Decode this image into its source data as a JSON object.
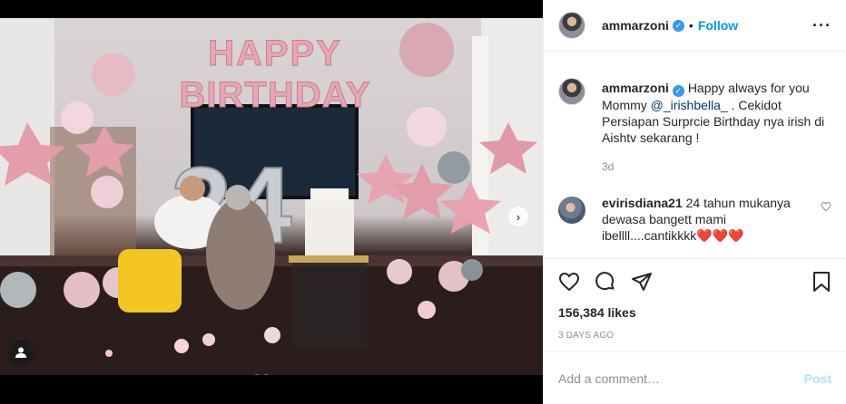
{
  "post": {
    "username": "ammarzoni",
    "follow_label": "Follow",
    "separator": "•",
    "more_icon": "more-horizontal-icon",
    "verified_icon": "verified-badge-icon"
  },
  "photo": {
    "balloon_text_top": "HAPPY",
    "balloon_text_bottom": "BIRTHDAY",
    "number_balloons": "24"
  },
  "caption": {
    "username": "ammarzoni",
    "text_1": "Happy always for you Mommy ",
    "mention": "@_irishbella_",
    "text_2": " . Cekidot Persiapan Surprcie Birthday nya irish di Aishtv sekarang !",
    "time": "3d"
  },
  "comment": {
    "username": "evirisdiana21",
    "text": "24 tahun mukanya dewasa bangett mami ibellll....cantikkkk",
    "emoji": "❤️❤️❤️"
  },
  "stats": {
    "likes": "156,384 likes",
    "posted": "3 DAYS AGO"
  },
  "composer": {
    "placeholder": "Add a comment…",
    "post_label": "Post"
  },
  "colors": {
    "accent": "#0095f6",
    "post_disabled": "#b2dffc",
    "balloon_pink": "#e7a7b2"
  }
}
